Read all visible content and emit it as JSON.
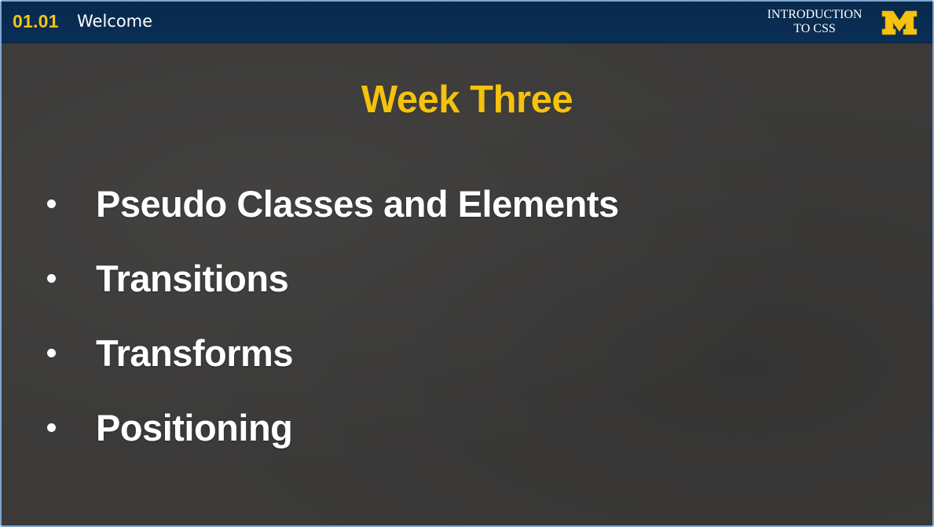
{
  "header": {
    "lesson_number": "01.01",
    "lesson_title": "Welcome",
    "course_name_line1": "INTRODUCTION",
    "course_name_line2": "TO CSS",
    "logo_icon": "block-m-logo"
  },
  "slide": {
    "title": "Week Three",
    "bullets": [
      "Pseudo Classes and Elements",
      "Transitions",
      "Transforms",
      "Positioning"
    ]
  },
  "colors": {
    "header_bg": "#07294d",
    "accent_gold": "#f4c20f",
    "slide_bg": "#3b3a39",
    "text": "#ffffff"
  }
}
